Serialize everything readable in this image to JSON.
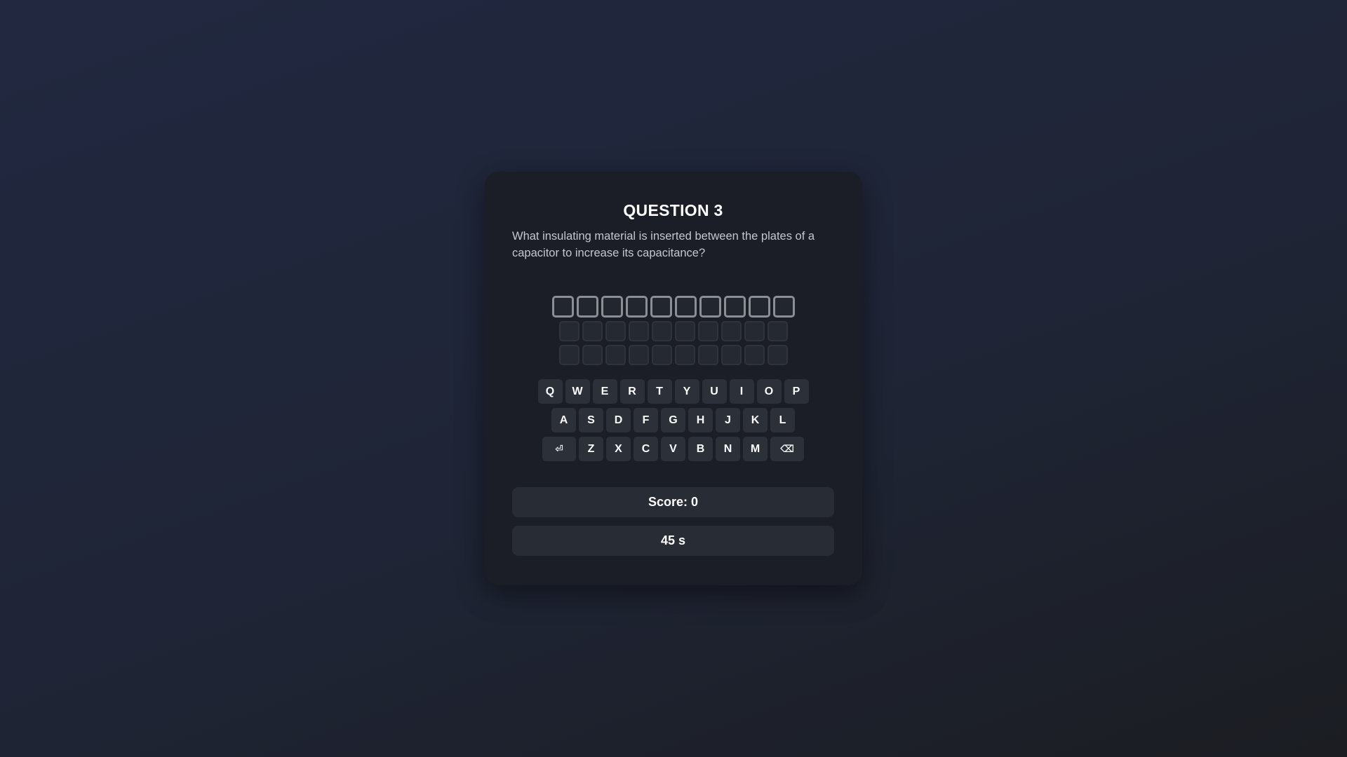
{
  "question": {
    "title": "QUESTION 3",
    "text": "What insulating material is inserted between the plates of a capacitor to increase its capacitance?"
  },
  "answer_grid": {
    "rows": 3,
    "letters": 10,
    "active_row": 0,
    "current_guess": ""
  },
  "keyboard": {
    "row1": [
      "Q",
      "W",
      "E",
      "R",
      "T",
      "Y",
      "U",
      "I",
      "O",
      "P"
    ],
    "row2": [
      "A",
      "S",
      "D",
      "F",
      "G",
      "H",
      "J",
      "K",
      "L"
    ],
    "row3": [
      "Z",
      "X",
      "C",
      "V",
      "B",
      "N",
      "M"
    ],
    "enter_icon": "enter-icon",
    "enter_glyph": "⏎",
    "backspace_icon": "backspace-icon",
    "backspace_glyph": "⌫"
  },
  "status": {
    "score": "Score: 0",
    "timer": "45 s"
  },
  "colors": {
    "background": "#1f2536",
    "card": "#1b1e26",
    "key": "#2c3039",
    "active_cell_border": "#8b8e94",
    "status_box": "#282c35"
  }
}
